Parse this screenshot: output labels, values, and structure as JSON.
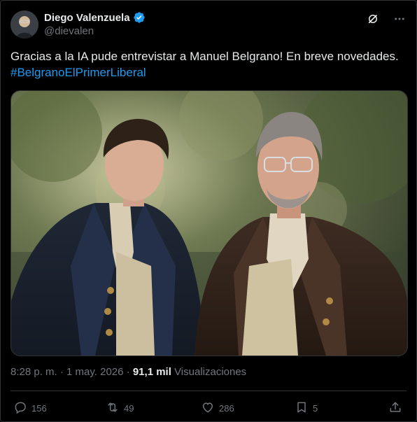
{
  "author": {
    "display_name": "Diego Valenzuela",
    "handle": "@dievalen",
    "verified": true
  },
  "tweet": {
    "text": "Gracias a la IA pude entrevistar a Manuel Belgrano! En breve novedades.",
    "hashtag": "#BelgranoElPrimerLiberal",
    "time": "8:28 p. m.",
    "separator": "·",
    "date": "1 may. 2026",
    "views_count": "91,1 mil",
    "views_label": "Visualizaciones"
  },
  "stats": {
    "replies": "156",
    "reposts": "49",
    "likes": "286",
    "bookmarks": "5"
  },
  "icons": {
    "verified": "verified-badge-icon",
    "grok": "grok-icon",
    "more": "more-icon",
    "reply": "reply-icon",
    "repost": "repost-icon",
    "like": "like-icon",
    "bookmark": "bookmark-icon",
    "share": "share-icon"
  },
  "colors": {
    "background": "#000000",
    "text": "#e7e9ea",
    "muted": "#71767b",
    "accent": "#1d9bf0",
    "border": "#2f3336"
  }
}
